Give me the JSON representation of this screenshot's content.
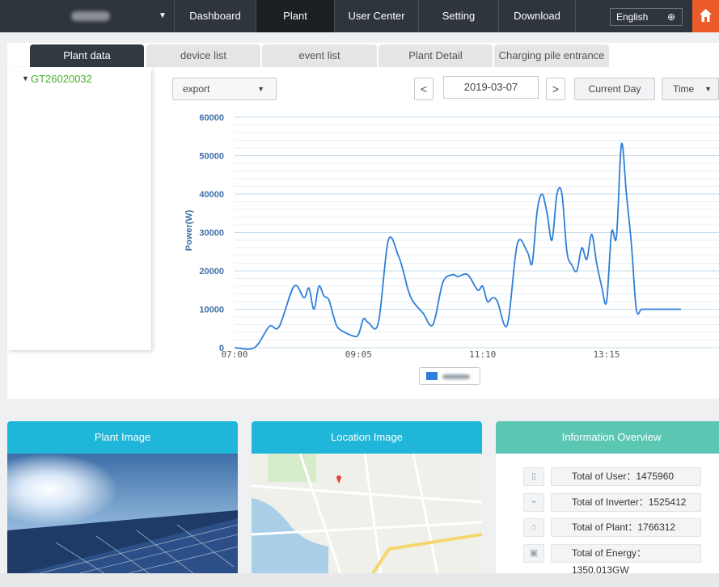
{
  "nav": {
    "items": [
      "Dashboard",
      "Plant",
      "User Center",
      "Setting",
      "Download"
    ],
    "active": "Plant",
    "language": "English"
  },
  "tabs": [
    "Plant data",
    "device list",
    "event list",
    "Plant Detail",
    "Charging pile entrance"
  ],
  "tree": {
    "node": "GT26020032"
  },
  "toolbar": {
    "export_label": "export",
    "date": "2019-03-07",
    "current_day_label": "Current Day",
    "time_label": "Time"
  },
  "chart_data": {
    "type": "line",
    "ylabel": "Power(W)",
    "ylim": [
      0,
      60000
    ],
    "yticks": [
      0,
      10000,
      20000,
      30000,
      40000,
      50000,
      60000
    ],
    "xticks": [
      "07:00",
      "09:05",
      "11:10",
      "13:15"
    ],
    "grid": "on",
    "line_color": "#2f7fd8",
    "series": [
      {
        "x": [
          "07:00",
          "07:20",
          "07:35",
          "07:45",
          "08:00",
          "08:10",
          "08:15",
          "08:20",
          "08:25",
          "08:30",
          "08:35",
          "08:40",
          "08:45",
          "09:00",
          "09:05",
          "09:10",
          "09:15",
          "09:25",
          "09:35",
          "09:45",
          "09:50",
          "09:55",
          "10:00",
          "10:10",
          "10:20",
          "10:30",
          "10:40",
          "10:45",
          "10:55",
          "11:05",
          "11:10",
          "11:15",
          "11:20",
          "11:25",
          "11:35",
          "11:45",
          "11:55",
          "12:00",
          "12:05",
          "12:10",
          "12:15",
          "12:20",
          "12:25",
          "12:30",
          "12:35",
          "12:40",
          "12:45",
          "12:50",
          "12:55",
          "13:00",
          "13:05",
          "13:10",
          "13:15",
          "13:20",
          "13:25",
          "13:30",
          "13:35",
          "13:40",
          "13:45",
          "13:50",
          "13:55",
          "14:00",
          "14:05",
          "14:10",
          "14:15",
          "14:20",
          "14:25",
          "14:30"
        ],
        "y": [
          0,
          0,
          5500,
          5500,
          16000,
          13000,
          15500,
          10000,
          16000,
          13500,
          12500,
          8000,
          5000,
          3000,
          3500,
          7500,
          6500,
          6500,
          28000,
          24000,
          20000,
          15000,
          12000,
          9000,
          6000,
          17000,
          19000,
          18500,
          19000,
          15000,
          16000,
          12000,
          13000,
          12000,
          6000,
          27000,
          25000,
          22000,
          35500,
          40000,
          35000,
          28000,
          40000,
          40000,
          25000,
          21500,
          20000,
          26000,
          23000,
          29500,
          22000,
          16000,
          12000,
          30000,
          29000,
          53000,
          40000,
          27000,
          10000,
          10000,
          10000,
          10000,
          10000,
          10000,
          10000,
          10000,
          10000,
          10000
        ]
      }
    ]
  },
  "cards": {
    "plant_image_title": "Plant Image",
    "location_image_title": "Location Image",
    "overview_title": "Information Overview",
    "overview_items": [
      {
        "label": "Total of User：1475960",
        "icon": "phone-icon"
      },
      {
        "label": "Total of Inverter：1525412",
        "icon": "inverter-icon"
      },
      {
        "label": "Total of Plant：1766312",
        "icon": "plant-icon"
      },
      {
        "label": "Total of Energy：1350.013GW",
        "icon": "energy-icon"
      }
    ]
  },
  "colors": {
    "topbar": "#2f353c",
    "accent_home": "#ec5b2a",
    "card_header_blue": "#1fb6d9",
    "card_header_teal": "#5bc7b3",
    "tree_node_green": "#43b02a"
  }
}
